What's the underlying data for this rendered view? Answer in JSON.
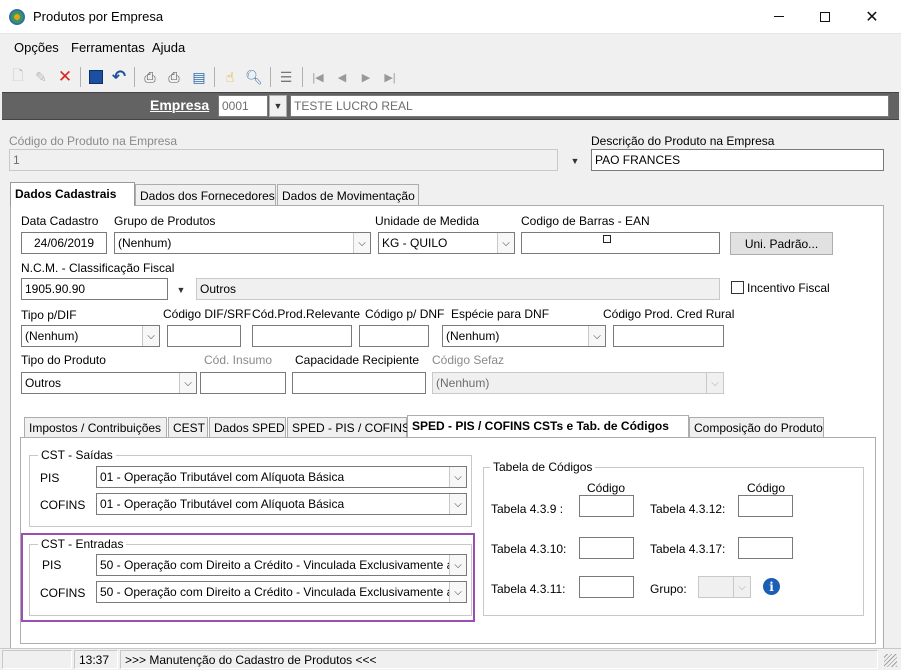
{
  "window": {
    "title": "Produtos por Empresa"
  },
  "menu": [
    "Opções",
    "Ferramentas",
    "Ajuda"
  ],
  "empresa": {
    "label": "Empresa",
    "code": "0001",
    "name": "TESTE LUCRO REAL"
  },
  "produto": {
    "codigo_label": "Código do Produto na Empresa",
    "codigo_value": "1",
    "descricao_label": "Descrição do Produto na Empresa",
    "descricao_value": "PAO FRANCES"
  },
  "tabs": [
    "Dados Cadastrais",
    "Dados dos Fornecedores",
    "Dados de Movimentação"
  ],
  "cadastro": {
    "data_cadastro_label": "Data Cadastro",
    "data_cadastro_value": "24/06/2019",
    "grupo_label": "Grupo de Produtos",
    "grupo_value": "(Nenhum)",
    "unidade_label": "Unidade de Medida",
    "unidade_value": "KG - QUILO",
    "ean_label": "Codigo de Barras - EAN",
    "ean_value": "",
    "uni_padrao_button": "Uni. Padrão...",
    "ncm_label": "N.C.M. -  Classificação Fiscal",
    "ncm_value": "1905.90.90",
    "ncm_desc": "Outros",
    "incentivo_label": "Incentivo Fiscal",
    "tipo_dif_label": "Tipo p/DIF",
    "tipo_dif_value": "(Nenhum)",
    "codigo_dif_label": "Código DIF/SRF",
    "codigo_dif_value": "",
    "cod_relevante_label": "Cód.Prod.Relevante",
    "cod_relevante_value": "",
    "codigo_dnf_label": "Código p/ DNF",
    "codigo_dnf_value": "",
    "especie_dnf_label": "Espécie para DNF",
    "especie_dnf_value": "(Nenhum)",
    "cred_rural_label": "Código Prod. Cred Rural",
    "cred_rural_value": "",
    "tipo_produto_label": "Tipo do Produto",
    "tipo_produto_value": "Outros",
    "cod_insumo_label": "Cód. Insumo",
    "cod_insumo_value": "",
    "capacidade_label": "Capacidade Recipiente",
    "capacidade_value": "",
    "sefaz_label": "Código Sefaz",
    "sefaz_value": "(Nenhum)"
  },
  "inner_tabs": [
    "Impostos / Contribuições",
    "CEST",
    "Dados SPED",
    "SPED - PIS / COFINS",
    "SPED - PIS / COFINS CSTs e Tab. de Códigos",
    "Composição do Produto"
  ],
  "cst_saidas": {
    "title": "CST - Saídas",
    "pis_label": "PIS",
    "pis_value": "01 - Operação Tributável com Alíquota Básica",
    "cofins_label": "COFINS",
    "cofins_value": "01 - Operação Tributável com Alíquota Básica"
  },
  "cst_entradas": {
    "title": "CST - Entradas",
    "pis_label": "PIS",
    "pis_value": "50 - Operação com Direito a Crédito - Vinculada Exclusivamente a",
    "cofins_label": "COFINS",
    "cofins_value": "50 - Operação com Direito a Crédito - Vinculada Exclusivamente a",
    "highlight_color": "#9b4fb0"
  },
  "tabela_codigos": {
    "title": "Tabela de Códigos",
    "codigo_header": "Código",
    "t439": "Tabela 4.3.9 :",
    "t4312": "Tabela 4.3.12:",
    "t4310": "Tabela 4.3.10:",
    "t4317": "Tabela 4.3.17:",
    "t4311": "Tabela 4.3.11:",
    "grupo": "Grupo:"
  },
  "status": {
    "time": "13:37",
    "message": ">>> Manutenção do Cadastro de Produtos <<<"
  }
}
